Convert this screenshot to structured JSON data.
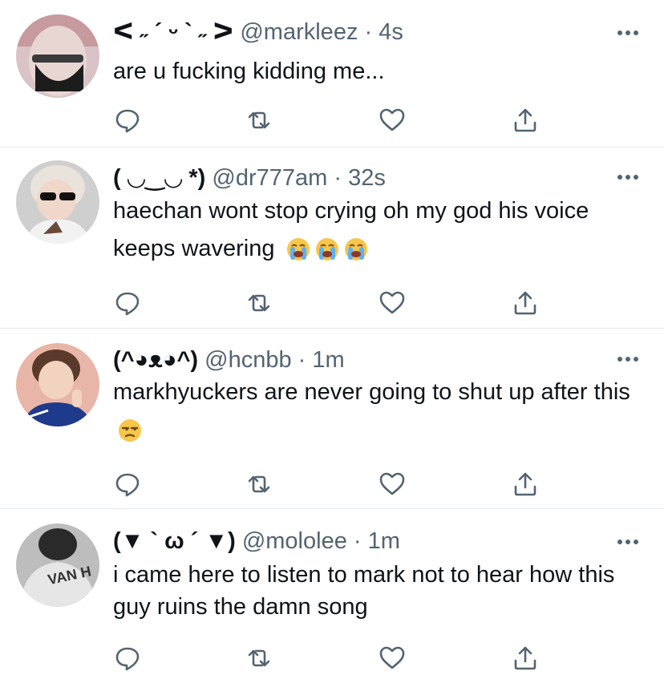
{
  "icons": {
    "reply": "reply-icon",
    "retweet": "retweet-icon",
    "like": "heart-icon",
    "share": "share-icon",
    "more": "more-icon"
  },
  "colors": {
    "text": "#0f1419",
    "muted": "#536471",
    "divider": "#e6ecf0"
  },
  "tweets": [
    {
      "name": "ᐸ ˶ ´ ᵕ ` ˶ ᐳ",
      "handle": "@markleez",
      "separator": "·",
      "time": "4s",
      "text": "are u fucking kidding me...",
      "emojis": []
    },
    {
      "name": "( ◡‿◡ *)",
      "handle": "@dr777am",
      "separator": "·",
      "time": "32s",
      "text": "haechan wont stop crying oh my god his voice keeps wavering",
      "emojis": [
        "loudly-crying-face",
        "loudly-crying-face",
        "loudly-crying-face"
      ]
    },
    {
      "name": "(^◕ᴥ◕^)",
      "handle": "@hcnbb",
      "separator": "·",
      "time": "1m",
      "text": "markhyuckers are never going to shut up after this",
      "emojis": [
        "unamused-face"
      ]
    },
    {
      "name": "(▼ ` ω ´ ▼)",
      "handle": "@mololee",
      "separator": "·",
      "time": "1m",
      "text": "i came here to listen to mark not to hear how this guy ruins the damn song",
      "emojis": []
    }
  ]
}
